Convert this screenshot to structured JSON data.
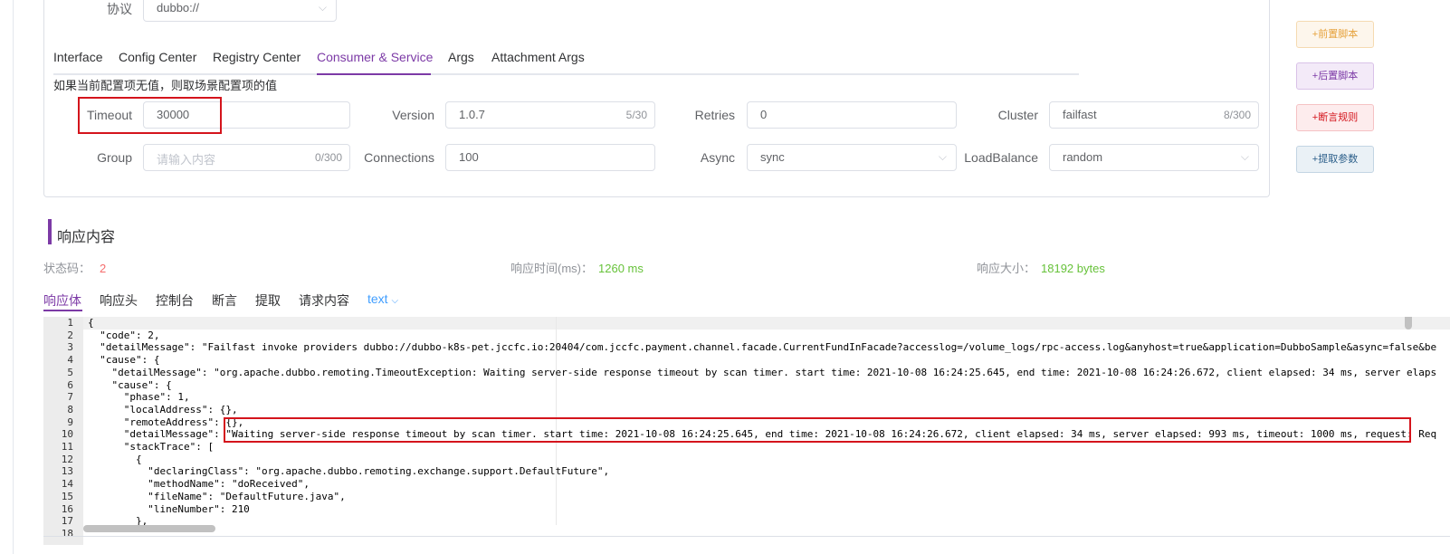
{
  "protocol": {
    "label": "协议",
    "value": "dubbo://"
  },
  "tabs": [
    {
      "label": "Interface"
    },
    {
      "label": "Config Center"
    },
    {
      "label": "Registry Center"
    },
    {
      "label": "Consumer & Service",
      "active": true
    },
    {
      "label": "Args"
    },
    {
      "label": "Attachment Args"
    }
  ],
  "hint": "如果当前配置项无值，则取场景配置项的值",
  "fields": {
    "timeout": {
      "label": "Timeout",
      "value": "30000"
    },
    "version": {
      "label": "Version",
      "value": "1.0.7",
      "count": "5/30"
    },
    "retries": {
      "label": "Retries",
      "value": "0"
    },
    "cluster": {
      "label": "Cluster",
      "value": "failfast",
      "count": "8/300"
    },
    "group": {
      "label": "Group",
      "placeholder": "请输入内容",
      "count": "0/300"
    },
    "connections": {
      "label": "Connections",
      "value": "100"
    },
    "async": {
      "label": "Async",
      "value": "sync"
    },
    "loadbalance": {
      "label": "LoadBalance",
      "value": "random"
    }
  },
  "side_buttons": {
    "pre_script": {
      "label": "+前置脚本",
      "color": "#e6a23c"
    },
    "post_script": {
      "label": "+后置脚本",
      "color": "#7c3aa6"
    },
    "assert_rule": {
      "label": "+断言规则",
      "color": "#d4141c"
    },
    "extract_param": {
      "label": "+提取参数",
      "color": "#2c5f8a"
    }
  },
  "response": {
    "title": "响应内容",
    "status_label": "状态码：",
    "status_value": "2",
    "time_label": "响应时间(ms)：",
    "time_value": "1260 ms",
    "size_label": "响应大小：",
    "size_value": "18192 bytes",
    "tabs": [
      {
        "label": "响应体",
        "active": true
      },
      {
        "label": "响应头"
      },
      {
        "label": "控制台"
      },
      {
        "label": "断言"
      },
      {
        "label": "提取"
      },
      {
        "label": "请求内容"
      }
    ],
    "mode": "text"
  },
  "code_lines": [
    "{",
    "  \"code\": 2,",
    "  \"detailMessage\": \"Failfast invoke providers dubbo://dubbo-k8s-pet.jccfc.io:20404/com.jccfc.payment.channel.facade.CurrentFundInFacade?accesslog=/volume_logs/rpc-access.log&anyhost=true&application=DubboSample&async=false&be",
    "  \"cause\": {",
    "    \"detailMessage\": \"org.apache.dubbo.remoting.TimeoutException: Waiting server-side response timeout by scan timer. start time: 2021-10-08 16:24:25.645, end time: 2021-10-08 16:24:26.672, client elapsed: 34 ms, server elaps",
    "    \"cause\": {",
    "      \"phase\": 1,",
    "      \"localAddress\": {},",
    "      \"remoteAddress\": {},",
    "      \"detailMessage\": \"Waiting server-side response timeout by scan timer. start time: 2021-10-08 16:24:25.645, end time: 2021-10-08 16:24:26.672, client elapsed: 34 ms, server elapsed: 993 ms, timeout: 1000 ms, request: Req",
    "      \"stackTrace\": [",
    "        {",
    "          \"declaringClass\": \"org.apache.dubbo.remoting.exchange.support.DefaultFuture\",",
    "          \"methodName\": \"doReceived\",",
    "          \"fileName\": \"DefaultFuture.java\",",
    "          \"lineNumber\": 210",
    "        },",
    ""
  ]
}
